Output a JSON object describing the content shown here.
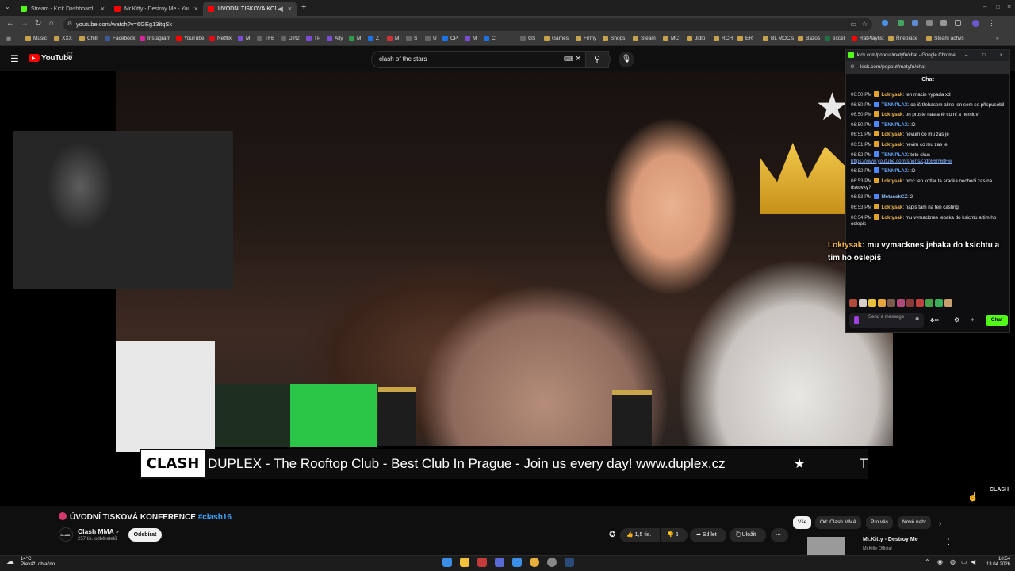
{
  "browser": {
    "tabs": [
      {
        "label": "Stream - Kick Dashboard",
        "color": "#53fc18"
      },
      {
        "label": "Mr.Kitty - Destroy Me - YouTube",
        "color": "#ff0000"
      },
      {
        "label": "ÚVODNÍ TISKOVÁ KONFERENCE",
        "color": "#ff0000"
      }
    ],
    "new_tab": "+",
    "url": "youtube.com/watch?v=6GEg13itqSk"
  },
  "bookmarks": [
    "Music",
    "XXX",
    "Chill",
    "Facebook",
    "Instagram",
    "YouTube",
    "Netflix",
    "M",
    "TFB",
    "Dirt2",
    "TP",
    "Ally",
    "M",
    "Z",
    "M",
    "S",
    "U",
    "CP",
    "M",
    "C",
    "GS",
    "Games",
    "Firmy",
    "Shops",
    "Steam",
    "MC",
    "Jidlo",
    "RCH",
    "ER",
    "BL MOC's",
    "Bazoš",
    "excel",
    "RatPlaylist",
    "Řnepiace",
    "Steam achvs"
  ],
  "youtube": {
    "logo": "YouTube",
    "logo_region": "CZ",
    "search_query": "clash of the stars",
    "video_title": "ÚVODNÍ TISKOVÁ KONFERENCE",
    "video_tag": "#clash16",
    "channel": "Clash MMA",
    "subscribers": "257 tis. odběratelů",
    "subscribe": "Odebírat",
    "likes": "1,5 tis.",
    "dislikes": "6",
    "share": "Sdílet",
    "save": "Uložit",
    "chips": [
      "Vše",
      "Od: Clash MMA",
      "Pro vás",
      "Nově nahr"
    ],
    "rec_title": "Mr.Kitty - Destroy Me",
    "rec_channel": "Mr.Kitty Official",
    "banner_logo": "CLASH",
    "banner_text": "DUPLEX - The Rooftop Club - Best Club In Prague - Join us every day! www.duplex.cz",
    "banner_star": "★",
    "banner_tail": "T",
    "watermark": "CLASH",
    "channel_avatar": "CLASH"
  },
  "chat": {
    "window_title": "kick.com/popout/matyfu/chat - Google Chrome",
    "url": "kick.com/popout/matyfu/chat",
    "header": "Chat",
    "messages": [
      {
        "time": "06:50 PM",
        "user": "Loktysak",
        "text": "ten macin vypada xd",
        "cls": "u1"
      },
      {
        "time": "06:50 PM",
        "user": "TENNPLAX",
        "text": "co iš třebasem aline jen sem se přispusobil",
        "cls": "u2"
      },
      {
        "time": "06:50 PM",
        "user": "Loktysak",
        "text": "on proste nasraně cumí a nemluví",
        "cls": "u1"
      },
      {
        "time": "06:50 PM",
        "user": "TENNPLAX",
        "text": ":D",
        "cls": "u2"
      },
      {
        "time": "06:51 PM",
        "user": "Loktysak",
        "text": "nevum co mu zas je",
        "cls": "u1"
      },
      {
        "time": "06:51 PM",
        "user": "Loktysak",
        "text": "nevim co mu zas je",
        "cls": "u1"
      },
      {
        "time": "06:52 PM",
        "user": "TENNPLAX",
        "text": "toto skus",
        "link": "https://www.youtube.com/shorts/Qdb86m6llFw",
        "cls": "u2"
      },
      {
        "time": "06:52 PM",
        "user": "TENNPLAX",
        "text": ":D",
        "cls": "u2"
      },
      {
        "time": "06:53 PM",
        "user": "Loktysak",
        "text": "proc ten kotlar ta sracka nechodi zas na tiskovky?",
        "cls": "u1"
      },
      {
        "time": "06:53 PM",
        "user": "MetacekCZ",
        "text": "2",
        "cls": "u3"
      },
      {
        "time": "06:53 PM",
        "user": "Loktysak",
        "text": "napis tam na ten casting",
        "cls": "u1"
      },
      {
        "time": "06:54 PM",
        "user": "Loktysak",
        "text": "mu vymacknes jebaka do ksichtu a tim ho oslepis",
        "cls": "u1"
      }
    ],
    "send_placeholder": "Send a message",
    "send_button": "Chat",
    "overlay_user": "Loktysak",
    "overlay_text": "mu vymacknes jebaka do ksichtu a tim ho oslepiš"
  },
  "taskbar": {
    "temp": "14°C",
    "weather": "Převáž. oblačno",
    "time": "18:54",
    "date": "13.04.2026"
  }
}
